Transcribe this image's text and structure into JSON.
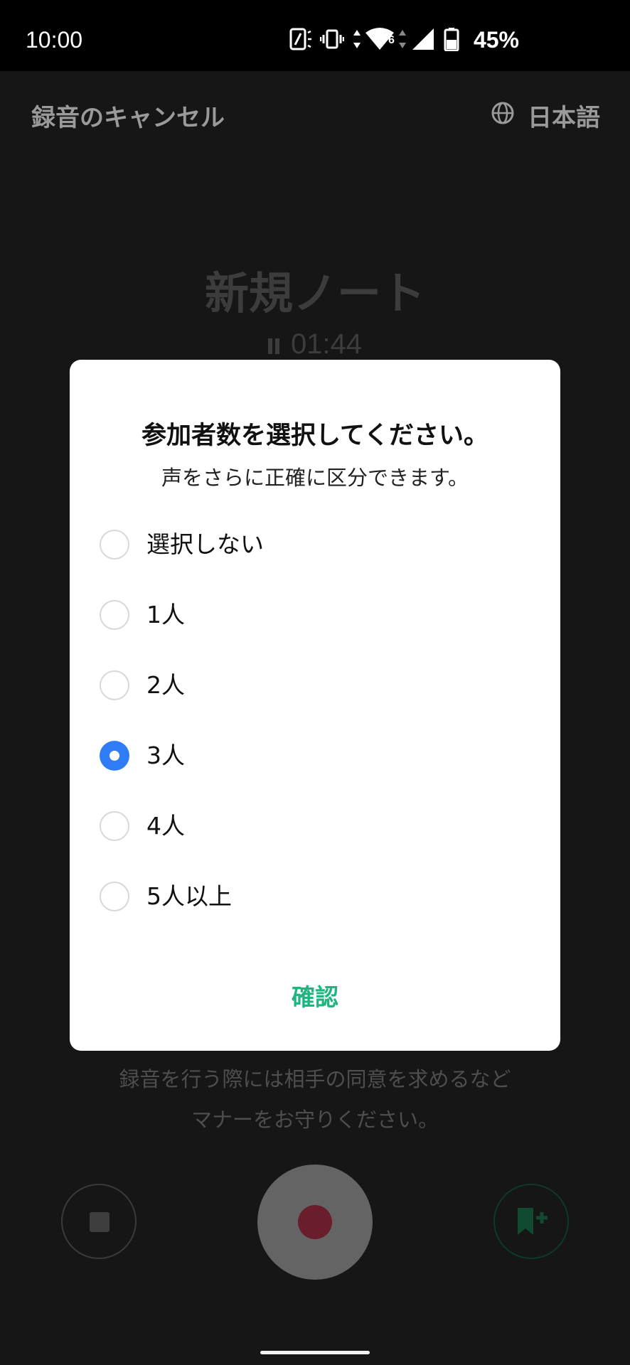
{
  "status_bar": {
    "time": "10:00",
    "battery": "45%",
    "network_badge": "6",
    "icons": [
      "nfc-icon",
      "vibrate-icon",
      "data-arrows-icon",
      "wifi-icon",
      "signal-icon",
      "battery-icon"
    ]
  },
  "header": {
    "cancel_label": "録音のキャンセル",
    "language_label": "日本語",
    "language_icon": "globe-icon"
  },
  "note": {
    "title": "新規ノート",
    "elapsed": "01:44"
  },
  "consent_text": {
    "line1": "録音を行う際には相手の同意を求めるなど",
    "line2": "マナーをお守りください。"
  },
  "controls": {
    "stop_icon": "stop-icon",
    "record_icon": "record-icon",
    "bookmark_icon": "bookmark-add-icon"
  },
  "dialog": {
    "title": "参加者数を選択してください。",
    "subtitle": "声をさらに正確に区分できます。",
    "options": [
      {
        "label": "選択しない",
        "selected": false
      },
      {
        "label": "1人",
        "selected": false
      },
      {
        "label": "2人",
        "selected": false
      },
      {
        "label": "3人",
        "selected": true
      },
      {
        "label": "4人",
        "selected": false
      },
      {
        "label": "5人以上",
        "selected": false
      }
    ],
    "confirm_label": "確認"
  },
  "colors": {
    "accent_green": "#1fb57f",
    "radio_selected": "#2f7cf6",
    "record_red": "#6a1d2a",
    "overlay_bg": "#161616"
  }
}
